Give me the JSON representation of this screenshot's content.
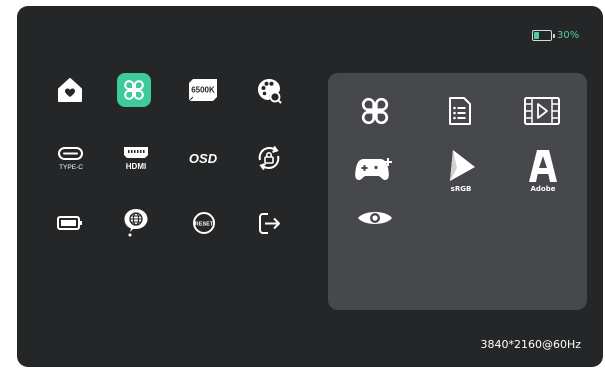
{
  "battery": {
    "percent_text": "30%",
    "level": 0.3,
    "color": "#4fd09b"
  },
  "menu": {
    "items": [
      {
        "icon": "home-icon"
      },
      {
        "icon": "preset-mode-icon",
        "selected": true
      },
      {
        "icon": "color-temperature-icon",
        "label": "6500K"
      },
      {
        "icon": "color-palette-icon"
      },
      {
        "icon": "usb-type-c-icon",
        "label": "TYPE-C"
      },
      {
        "icon": "hdmi-icon",
        "label": "HDMI"
      },
      {
        "icon": "osd-icon",
        "label": "OSD"
      },
      {
        "icon": "rotation-lock-icon"
      },
      {
        "icon": "battery-setting-icon"
      },
      {
        "icon": "language-icon"
      },
      {
        "icon": "reset-icon",
        "label": "RESET"
      },
      {
        "icon": "exit-icon"
      }
    ]
  },
  "submenu": {
    "items": [
      {
        "icon": "standard-mode-icon"
      },
      {
        "icon": "text-mode-icon"
      },
      {
        "icon": "movie-mode-icon"
      },
      {
        "icon": "game-mode-icon"
      },
      {
        "icon": "srgb-mode-icon",
        "label": "sRGB"
      },
      {
        "icon": "adobe-mode-icon",
        "label": "Adobe"
      },
      {
        "icon": "eye-care-icon"
      }
    ]
  },
  "status": {
    "resolution": "3840*2160@60Hz"
  },
  "colors": {
    "accent": "#3ecb99",
    "background": "#252628",
    "panel": "#46484c"
  }
}
